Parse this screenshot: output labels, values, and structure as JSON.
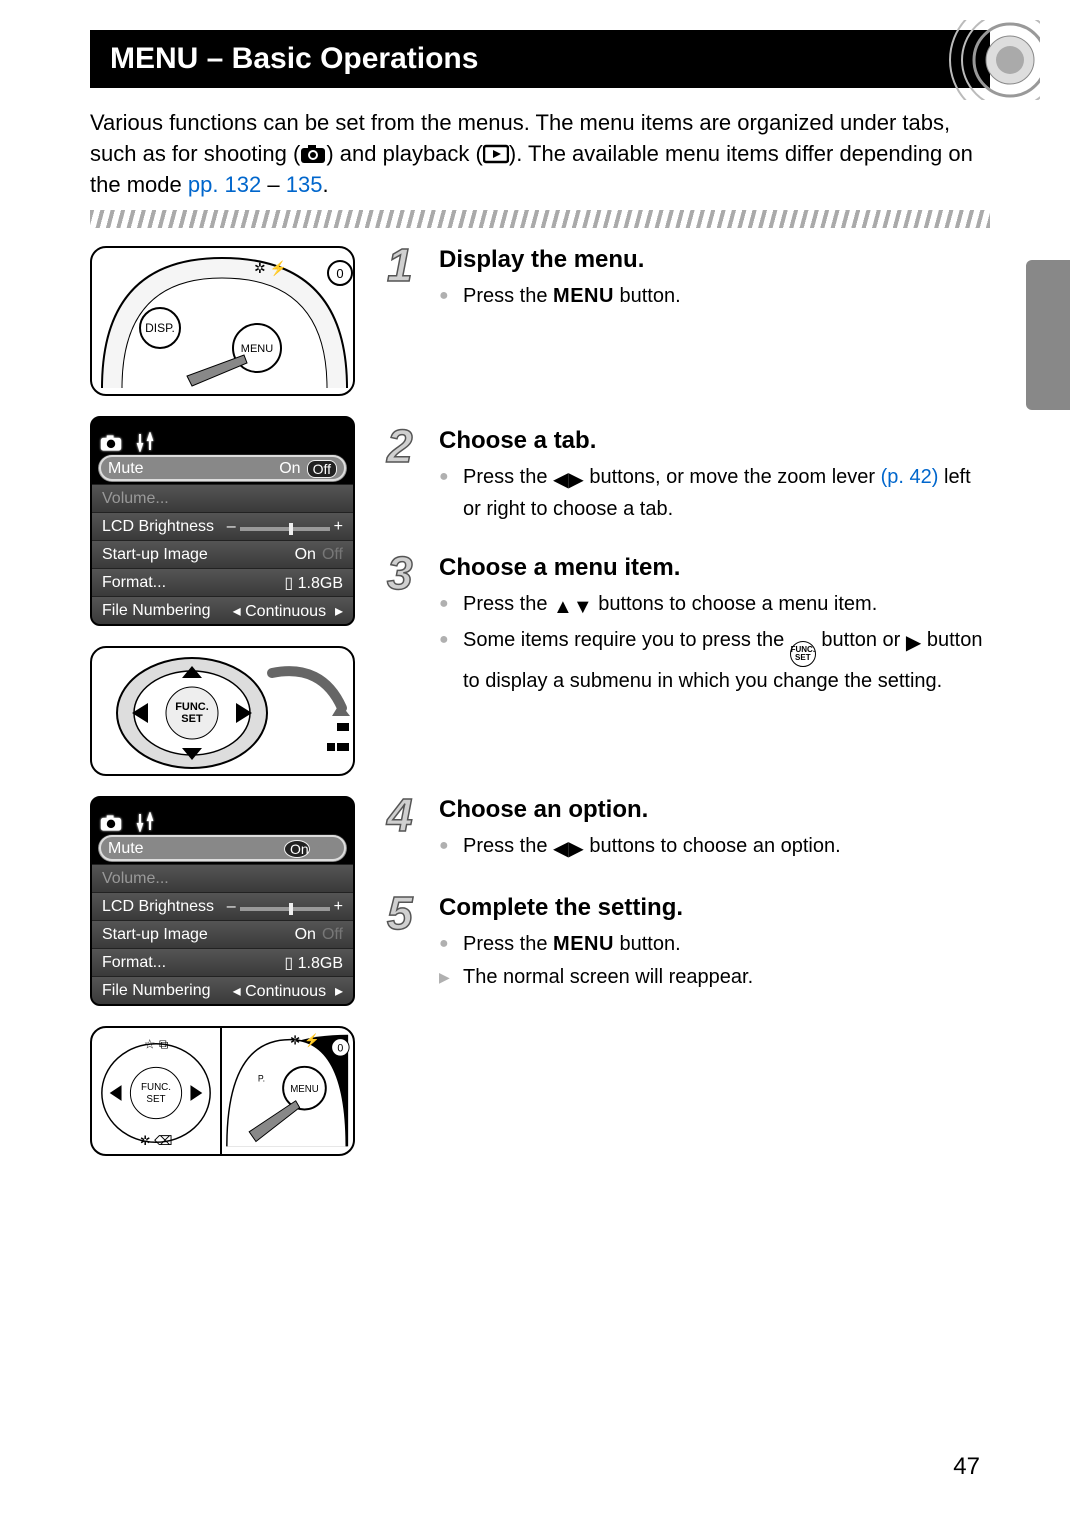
{
  "header": {
    "title": "MENU – Basic Operations"
  },
  "intro": {
    "line1a": "Various functions can be set from the menus. The menu items are organized under tabs, such as for shooting (",
    "line1b": ") and playback (",
    "line1c": "). The available menu items differ depending on the mode ",
    "link_pp_a": "pp. 132",
    "dash": " – ",
    "link_pp_b": "135",
    "period": "."
  },
  "steps": [
    {
      "num": "1",
      "title": "Display the menu.",
      "lines": [
        {
          "type": "bullet",
          "pre": "Press the ",
          "label": "MENU",
          "post": " button."
        }
      ]
    },
    {
      "num": "2",
      "title": "Choose a tab.",
      "lines": [
        {
          "type": "bullet",
          "pre": "Press the ",
          "icon": "lr",
          "post": " buttons, or move the zoom lever ",
          "link": "(p. 42)",
          "tail": " left or right to choose a tab."
        }
      ]
    },
    {
      "num": "3",
      "title": "Choose a menu item.",
      "lines": [
        {
          "type": "bullet",
          "pre": "Press the ",
          "icon": "ud",
          "post": " buttons to choose a menu item."
        },
        {
          "type": "bullet",
          "pre": "Some items require you to press the ",
          "icon": "funcset",
          "post": " button or ",
          "icon2": "right",
          "tail": " button to display a submenu in which you change the setting."
        }
      ]
    },
    {
      "num": "4",
      "title": "Choose an option.",
      "lines": [
        {
          "type": "bullet",
          "pre": "Press the ",
          "icon": "lr",
          "post": " buttons to choose an option."
        }
      ]
    },
    {
      "num": "5",
      "title": "Complete the setting.",
      "lines": [
        {
          "type": "bullet",
          "pre": "Press the ",
          "label": "MENU",
          "post": " button."
        },
        {
          "type": "result",
          "text": "The normal screen will reappear."
        }
      ]
    }
  ],
  "screen": {
    "rows": [
      {
        "label": "Mute",
        "value_on": "On",
        "value_off": "Off"
      },
      {
        "label": "Volume..."
      },
      {
        "label": "LCD Brightness",
        "slider": true,
        "minus": "–",
        "plus": "+"
      },
      {
        "label": "Start-up Image",
        "value_on": "On",
        "value_off": "Off"
      },
      {
        "label": "Format...",
        "value": "1.8GB"
      },
      {
        "label": "File Numbering",
        "value": "Continuous"
      }
    ]
  },
  "camera_labels": {
    "disp": "DISP.",
    "menu": "MENU"
  },
  "func": {
    "top": "FUNC.",
    "bot": "SET"
  },
  "page_number": "47"
}
